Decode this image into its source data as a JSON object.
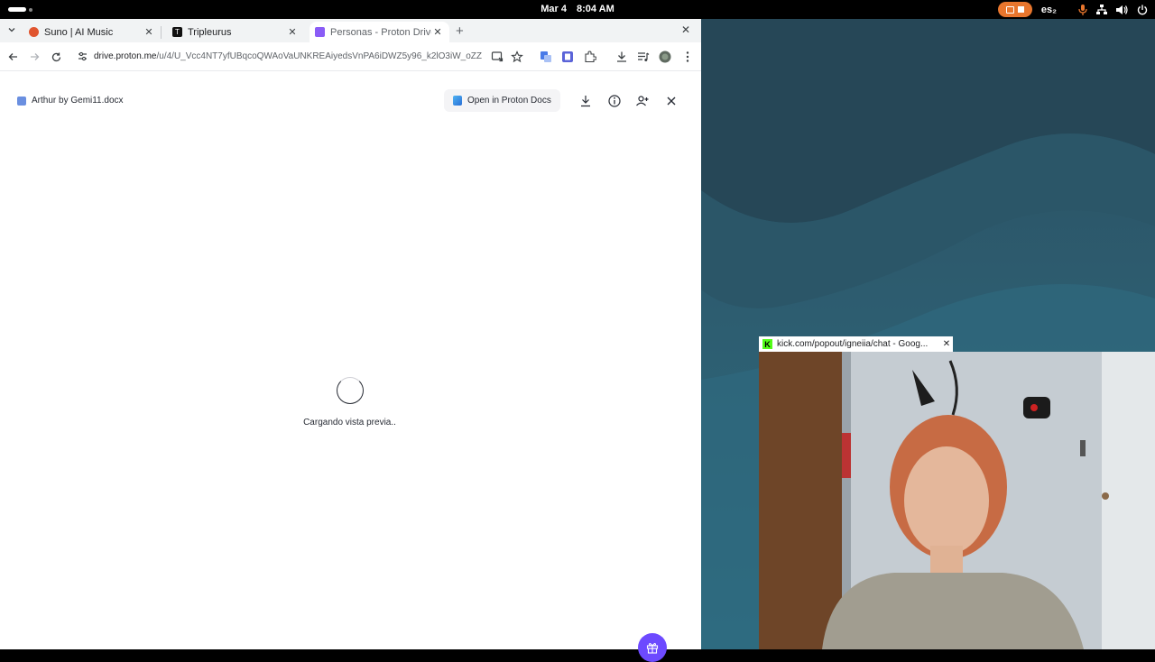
{
  "system_bar": {
    "date": "Mar 4",
    "time": "8:04 AM",
    "keyboard_layout": "es₂"
  },
  "browser": {
    "tabs": [
      {
        "title": "Suno | AI Music",
        "favicon_color": "#e0552f",
        "active": false
      },
      {
        "title": "Tripleurus",
        "favicon_color": "#111111",
        "active": false
      },
      {
        "title": "Personas - Proton Drive",
        "favicon_color": "#8a5cf6",
        "active": true
      }
    ],
    "url_host": "drive.proton.me",
    "url_path": "/u/4/U_Vcc4NT7yfUBqcoQWAoVaUNKREAiyedsVnPA6iDWZ5y96_k2lO3iW_oZZWAs..."
  },
  "drive": {
    "file_name": "Arthur by Gemi11.docx",
    "open_button_label": "Open in Proton Docs",
    "loading_text": "Cargando vista previa..",
    "accent_color": "#6d4aff"
  },
  "popout": {
    "title": "kick.com/popout/igneiia/chat - Goog..."
  }
}
